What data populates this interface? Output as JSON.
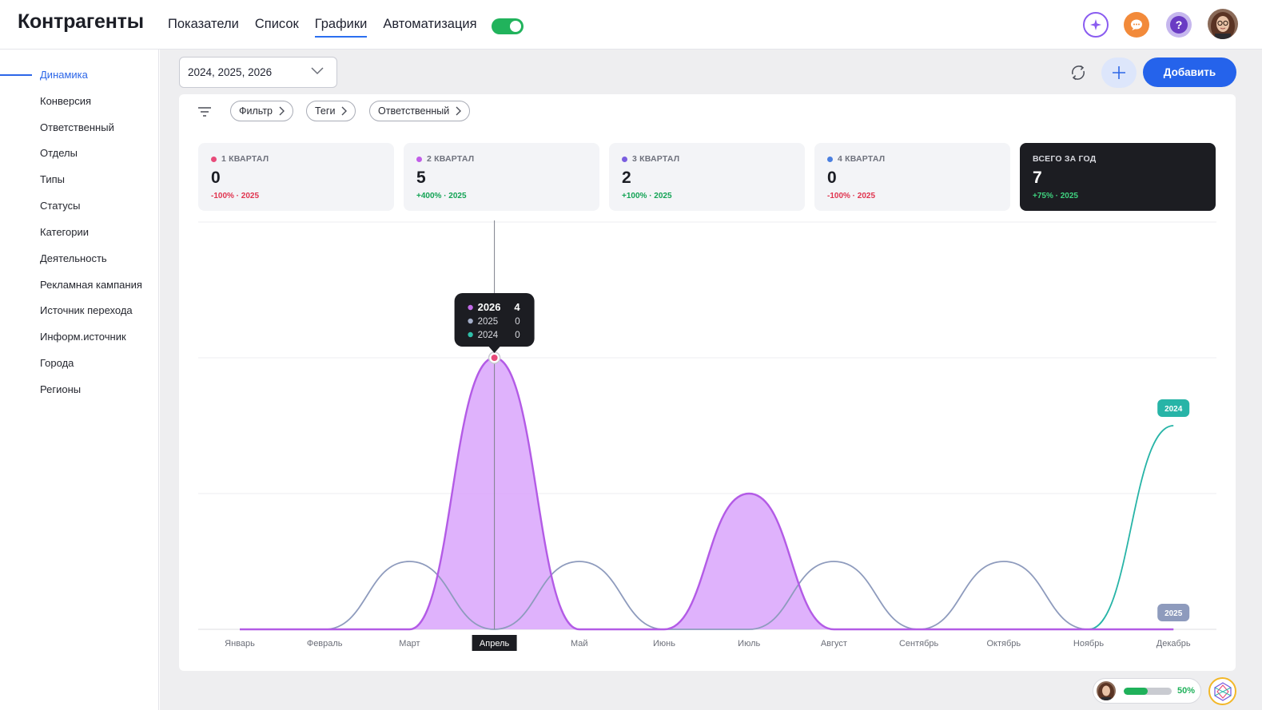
{
  "header": {
    "title": "Контрагенты",
    "tabs": [
      {
        "label": "Показатели"
      },
      {
        "label": "Список"
      },
      {
        "label": "Графики",
        "active": true
      },
      {
        "label": "Автоматизация"
      }
    ],
    "toggle_on": true,
    "icons": [
      "ai-sparkle-icon",
      "chat-icon",
      "help-icon",
      "user-avatar"
    ],
    "help_glyph": "?"
  },
  "sidebar": {
    "items": [
      {
        "label": "Динамика",
        "active": true
      },
      {
        "label": "Конверсия"
      },
      {
        "label": "Ответственный"
      },
      {
        "label": "Отделы"
      },
      {
        "label": "Типы"
      },
      {
        "label": "Статусы"
      },
      {
        "label": "Категории"
      },
      {
        "label": "Деятельность"
      },
      {
        "label": "Рекламная кампания"
      },
      {
        "label": "Источник перехода"
      },
      {
        "label": "Информ.источник"
      },
      {
        "label": "Города"
      },
      {
        "label": "Регионы"
      }
    ]
  },
  "toolbar": {
    "year_select_value": "2024, 2025, 2026",
    "add_label": "Добавить"
  },
  "filters": {
    "chips": [
      "Фильтр",
      "Теги",
      "Ответственный"
    ]
  },
  "kpis": [
    {
      "label": "1 КВАРТАЛ",
      "value": "0",
      "delta": "-100% · 2025",
      "dot_color": "#e84b7a",
      "delta_color": "#e0344f"
    },
    {
      "label": "2 КВАРТАЛ",
      "value": "5",
      "delta": "+400% · 2025",
      "dot_color": "#c15de8",
      "delta_color": "#13a355"
    },
    {
      "label": "3 КВАРТАЛ",
      "value": "2",
      "delta": "+100% · 2025",
      "dot_color": "#7a5ee0",
      "delta_color": "#13a355"
    },
    {
      "label": "4 КВАРТАЛ",
      "value": "0",
      "delta": "-100% · 2025",
      "dot_color": "#4a7fe0",
      "delta_color": "#e0344f"
    },
    {
      "label": "ВСЕГО ЗА ГОД",
      "value": "7",
      "delta": "+75% · 2025",
      "dark": true,
      "delta_color": "#3fd27f"
    }
  ],
  "chart_data": {
    "type": "area",
    "categories": [
      "Январь",
      "Февраль",
      "Март",
      "Апрель",
      "Май",
      "Июнь",
      "Июль",
      "Август",
      "Сентябрь",
      "Октябрь",
      "Ноябрь",
      "Декабрь"
    ],
    "ylim": [
      0,
      4
    ],
    "grid": true,
    "series": [
      {
        "name": "2026",
        "values": [
          0,
          0,
          0,
          4,
          0,
          0,
          2,
          0,
          0,
          0,
          0,
          0
        ],
        "color": "#b35be6",
        "fill": "#d9a4fb"
      },
      {
        "name": "2025",
        "values": [
          0,
          0,
          1,
          0,
          1,
          0,
          0,
          1,
          0,
          1,
          0,
          0
        ],
        "color": "#8e9bbd"
      },
      {
        "name": "2024",
        "values": [
          0,
          0,
          0,
          0,
          0,
          0,
          0,
          0,
          0,
          0,
          0,
          3
        ],
        "color": "#27b4a7"
      }
    ],
    "end_labels": [
      "2024",
      "2025"
    ],
    "highlight_category": "Апрель",
    "tooltip": {
      "rows": [
        {
          "year": "2026",
          "value": "4",
          "color": "#c26be8"
        },
        {
          "year": "2025",
          "value": "0",
          "color": "#a3aec8"
        },
        {
          "year": "2024",
          "value": "0",
          "color": "#2fbfa9"
        }
      ]
    }
  },
  "footer": {
    "progress": 0.5,
    "progress_label": "50%"
  }
}
